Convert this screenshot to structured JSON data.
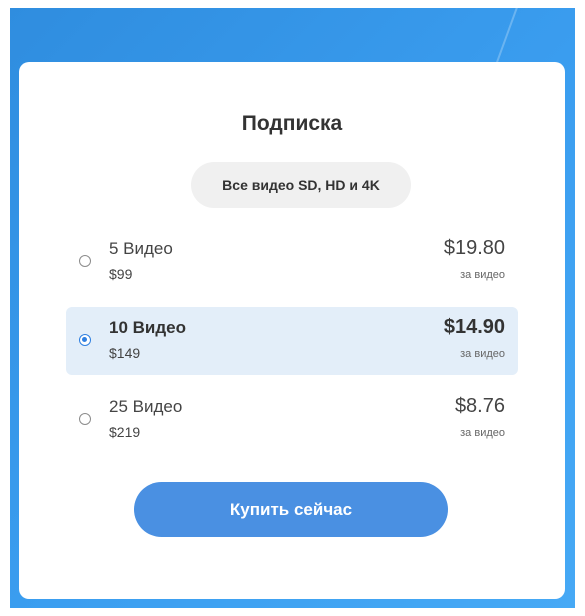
{
  "title": "Подписка",
  "quality_badge": "Все видео SD, HD и 4K",
  "plans": [
    {
      "name": "5 Видео",
      "price": "$99",
      "per_video_price": "$19.80",
      "per_video_label": "за видео",
      "selected": false
    },
    {
      "name": "10 Видео",
      "price": "$149",
      "per_video_price": "$14.90",
      "per_video_label": "за видео",
      "selected": true
    },
    {
      "name": "25 Видео",
      "price": "$219",
      "per_video_price": "$8.76",
      "per_video_label": "за видео",
      "selected": false
    }
  ],
  "buy_button_label": "Купить сейчас",
  "colors": {
    "background": "#3b9ef0",
    "accent": "#4a90e2",
    "selected_row": "#e3eef9",
    "radio_selected": "#2f7fe0"
  }
}
